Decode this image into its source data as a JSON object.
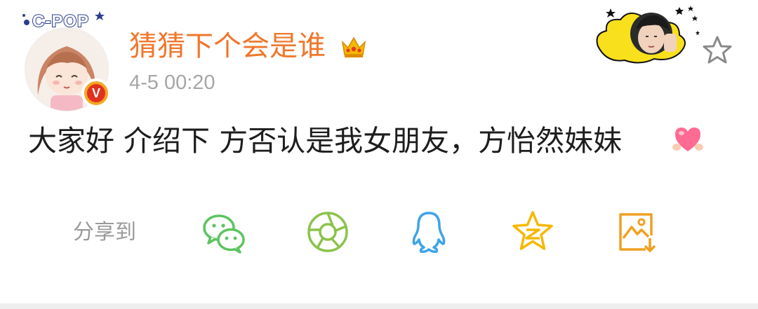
{
  "watermark": {
    "logo_text": "C-POP"
  },
  "post": {
    "username": "猜猜下个会是谁",
    "timestamp": "4-5 00:20",
    "text": "大家好 介绍下 方否认是我女朋友，方怡然妹妹",
    "verified_badge": "V"
  },
  "share": {
    "label": "分享到",
    "targets": [
      {
        "name": "wechat",
        "icon": "wechat-icon"
      },
      {
        "name": "moments",
        "icon": "moments-icon"
      },
      {
        "name": "qq",
        "icon": "qq-icon"
      },
      {
        "name": "qzone",
        "icon": "qzone-icon"
      },
      {
        "name": "save-image",
        "icon": "save-image-icon"
      }
    ]
  },
  "colors": {
    "username": "#f0772c",
    "timestamp": "#a6a6a6",
    "text": "#1d1d1d",
    "wechat": "#5bc45f",
    "moments": "#8bc34a",
    "qq": "#3da4e8",
    "qzone": "#f5b800",
    "save": "#f0a020"
  }
}
